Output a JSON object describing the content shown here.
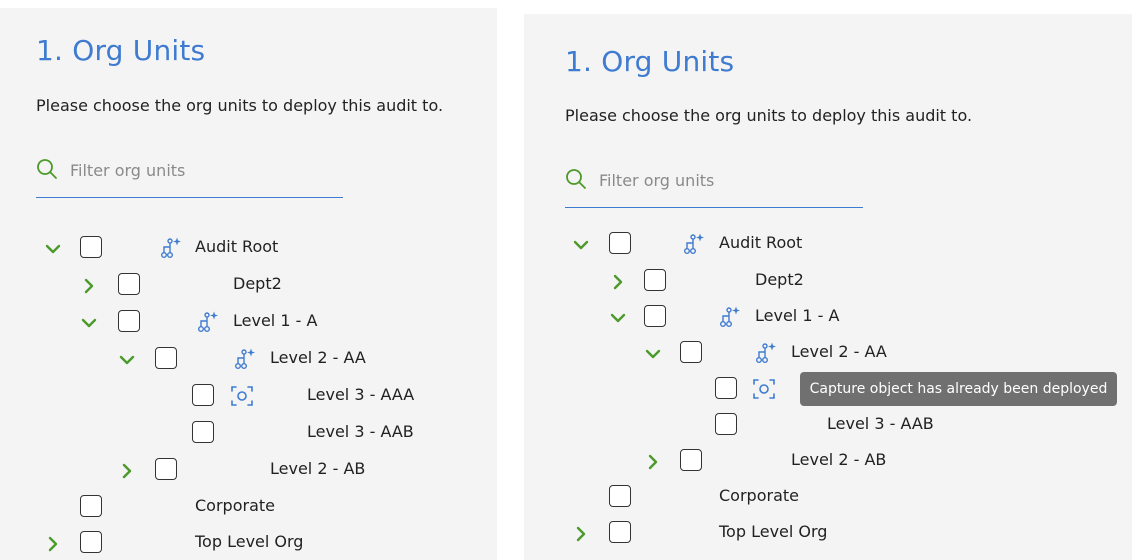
{
  "panels": [
    {
      "title": "1. Org Units",
      "description": "Please choose the org units to deploy this audit to.",
      "filter_placeholder": "Filter org units",
      "tree": [
        {
          "label": "Audit Root",
          "chevron": "down",
          "icon": "org-hierarchy-icon"
        },
        {
          "label": "Dept2",
          "chevron": "right",
          "icon": ""
        },
        {
          "label": "Level 1 - A",
          "chevron": "down",
          "icon": "org-hierarchy-icon"
        },
        {
          "label": "Level 2 - AA",
          "chevron": "down",
          "icon": "org-hierarchy-icon"
        },
        {
          "label": "Level 3 - AAA",
          "chevron": "",
          "icon": "capture-object-icon"
        },
        {
          "label": "Level 3 - AAB",
          "chevron": "",
          "icon": ""
        },
        {
          "label": "Level 2 - AB",
          "chevron": "right",
          "icon": ""
        },
        {
          "label": "Corporate",
          "chevron": "",
          "icon": ""
        },
        {
          "label": "Top Level Org",
          "chevron": "right",
          "icon": ""
        }
      ]
    },
    {
      "title": "1. Org Units",
      "description": "Please choose the org units to deploy this audit to.",
      "filter_placeholder": "Filter org units",
      "tree": [
        {
          "label": "Audit Root",
          "chevron": "down",
          "icon": "org-hierarchy-icon"
        },
        {
          "label": "Dept2",
          "chevron": "right",
          "icon": ""
        },
        {
          "label": "Level 1 - A",
          "chevron": "down",
          "icon": "org-hierarchy-icon"
        },
        {
          "label": "Level 2 - AA",
          "chevron": "down",
          "icon": "org-hierarchy-icon"
        },
        {
          "label": "",
          "chevron": "",
          "icon": "capture-object-icon"
        },
        {
          "label": "Level 3 - AAB",
          "chevron": "",
          "icon": ""
        },
        {
          "label": "Level 2 - AB",
          "chevron": "right",
          "icon": ""
        },
        {
          "label": "Corporate",
          "chevron": "",
          "icon": ""
        },
        {
          "label": "Top Level Org",
          "chevron": "right",
          "icon": ""
        }
      ]
    }
  ],
  "tooltip": {
    "text": "Capture object has already been deployed"
  },
  "colors": {
    "accent": "#3f7bd0",
    "chevron": "#4c9a2a",
    "panel_bg": "#f4f4f4",
    "tooltip_bg": "#707070"
  }
}
